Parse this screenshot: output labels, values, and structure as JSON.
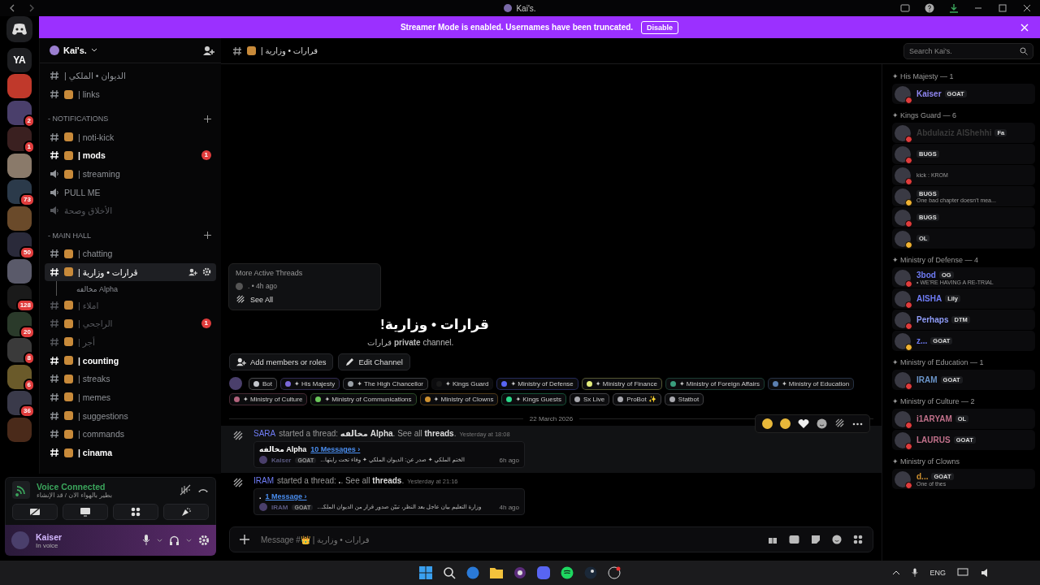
{
  "window": {
    "title": "Kai's."
  },
  "banner": {
    "text": "Streamer Mode is enabled. Usernames have been truncated.",
    "button": "Disable"
  },
  "servers": [
    {
      "label": "YA",
      "color": "#1e1f22"
    },
    {
      "color": "#c0392b"
    },
    {
      "badge": "2",
      "color": "#4a3f6b"
    },
    {
      "badge": "1",
      "color": "#3a2020"
    },
    {
      "color": "#8a7a6a"
    },
    {
      "badge": "73",
      "color": "#2b3a4a"
    },
    {
      "color": "#6a4a2a"
    },
    {
      "badge": "50",
      "color": "#2a2a3a"
    },
    {
      "color": "#5a5a6a"
    },
    {
      "badge": "128",
      "color": "#1a1a1a"
    },
    {
      "badge": "20",
      "color": "#2a3a2a"
    },
    {
      "badge": "8",
      "color": "#3a3a3a"
    },
    {
      "badge": "6",
      "color": "#6a5a2a"
    },
    {
      "badge": "36",
      "color": "#3a3a4a"
    },
    {
      "color": "#4a2a1a"
    }
  ],
  "server": {
    "name": "Kai's."
  },
  "channels": [
    {
      "kind": "text",
      "name": "| الديوان • الملكي",
      "emoji": false,
      "unread": false,
      "muted": false,
      "selected": false
    },
    {
      "kind": "text",
      "name": "| links",
      "emoji": true,
      "unread": false,
      "muted": false,
      "selected": false
    },
    {
      "kind": "category",
      "name": "- NOTIFICATIONS"
    },
    {
      "kind": "text",
      "name": "| noti-kick",
      "emoji": true,
      "unread": false,
      "muted": false,
      "selected": false
    },
    {
      "kind": "text",
      "name": "| mods",
      "emoji": true,
      "unread": true,
      "muted": false,
      "selected": false,
      "badge": "1"
    },
    {
      "kind": "voice",
      "name": "| streaming",
      "emoji": true,
      "unread": false,
      "muted": false,
      "selected": false
    },
    {
      "kind": "voice",
      "name": "PULL ME",
      "emoji": false,
      "unread": false,
      "muted": false,
      "selected": false
    },
    {
      "kind": "voice",
      "name": "الأخلاق وصحة",
      "emoji": false,
      "unread": false,
      "muted": true,
      "selected": false
    },
    {
      "kind": "category",
      "name": "- MAIN HALL"
    },
    {
      "kind": "text",
      "name": "| chatting",
      "emoji": true,
      "unread": false,
      "muted": false,
      "selected": false
    },
    {
      "kind": "text",
      "name": "| قرارات • وزارية",
      "emoji": true,
      "unread": false,
      "muted": false,
      "selected": true
    },
    {
      "kind": "thread",
      "name": "مخالفه Alpha"
    },
    {
      "kind": "text",
      "name": "| املاء",
      "emoji": true,
      "unread": false,
      "muted": true,
      "selected": false
    },
    {
      "kind": "text",
      "name": "| الراجحي",
      "emoji": true,
      "unread": false,
      "muted": true,
      "selected": false,
      "badge": "1"
    },
    {
      "kind": "text",
      "name": "| أجر",
      "emoji": true,
      "unread": false,
      "muted": true,
      "selected": false
    },
    {
      "kind": "text",
      "name": "| counting",
      "emoji": true,
      "unread": true,
      "muted": false,
      "selected": false
    },
    {
      "kind": "text",
      "name": "| streaks",
      "emoji": true,
      "unread": false,
      "muted": false,
      "selected": false
    },
    {
      "kind": "text",
      "name": "| memes",
      "emoji": true,
      "unread": false,
      "muted": false,
      "selected": false
    },
    {
      "kind": "text",
      "name": "| suggestions",
      "emoji": true,
      "unread": false,
      "muted": false,
      "selected": false
    },
    {
      "kind": "text",
      "name": "| commands",
      "emoji": true,
      "unread": false,
      "muted": false,
      "selected": false
    },
    {
      "kind": "text",
      "name": "| cinama",
      "emoji": true,
      "unread": true,
      "muted": false,
      "selected": false
    }
  ],
  "voice": {
    "title": "Voice Connected",
    "channel": "بطير بالهواء الان / قد الإنشاء"
  },
  "user": {
    "name": "Kaiser",
    "status": "In voice"
  },
  "header": {
    "channel": "| قرارات • وزارية",
    "search_placeholder": "Search Kai's."
  },
  "threads_popup": {
    "title": "More Active Threads",
    "item": ". • 4h ago",
    "see_all": "See All"
  },
  "welcome": {
    "title": "قرارات • وزارية!",
    "subtitle": "قرارات **private** channel.",
    "buttons": [
      "Add members or roles",
      "Edit Channel"
    ]
  },
  "roles": [
    {
      "label": "Bot",
      "color": "#c4c6cc"
    },
    {
      "label": "✦ His Majesty",
      "color": "#7b68d9"
    },
    {
      "label": "✦ The High Chancellor",
      "color": "#9aa0a6"
    },
    {
      "label": "✦ Kings Guard",
      "color": "#1a1a1a"
    },
    {
      "label": "✦ Ministry of Defense",
      "color": "#5865f2"
    },
    {
      "label": "✦ Ministry of Finance",
      "color": "#e4ee7c"
    },
    {
      "label": "✦ Ministry of Foreign Affairs",
      "color": "#3a9f7e"
    },
    {
      "label": "✦ Ministry of Education",
      "color": "#5b7fb0"
    },
    {
      "label": "✦ Ministry of Culture",
      "color": "#b4647e"
    },
    {
      "label": "✦ Ministry of Communications",
      "color": "#6ac85a"
    },
    {
      "label": "✦ Ministry of Clowns",
      "color": "#d09230"
    },
    {
      "label": "✦ Kings Guests",
      "color": "#2bd98a"
    },
    {
      "label": "Sx Live",
      "color": "#a8a8ae"
    },
    {
      "label": "ProBot ✨",
      "color": "#a8a8ae"
    },
    {
      "label": "Statbot",
      "color": "#a8a8ae"
    }
  ],
  "date_divider": "22 March 2026",
  "messages": [
    {
      "author": "SARA",
      "text": "started a thread: **مخالفه Alpha**. See all **threads**.",
      "time": "Yesterday at 18:08",
      "highlighted": true,
      "thread": {
        "name": "مخالفه Alpha",
        "count": "10 Messages ›",
        "author": "Kaiser",
        "tag": "GOAT",
        "preview": "الختم الملكي ✦ صدر عن: الديوان الملكي ✦ وفاء تحت رايتها...",
        "ago": "6h ago"
      }
    },
    {
      "author": "IRAM",
      "text": "started a thread: **.**. See all **threads**.",
      "time": "Yesterday at 21:16",
      "highlighted": false,
      "thread": {
        "name": ".",
        "count": "1 Message ›",
        "author": "IRAM",
        "tag": "GOAT",
        "preview": "وزارة التعليم بيان عاجل بعد النظر، تبيّن صدور قرار من الديوان الملكـ...",
        "ago": "4h ago"
      }
    }
  ],
  "composer": {
    "placeholder": "Message #👑 | قرارات • وزارية"
  },
  "member_groups": [
    {
      "title": "✦ His Majesty — 1",
      "members": [
        {
          "name": "Kaiser",
          "color": "#8f86f0",
          "tag": "GOAT",
          "idle": false
        }
      ]
    },
    {
      "title": "✦ Kings Guard — 6",
      "members": [
        {
          "name": "Abdulaziz AlShehhi",
          "color": "#3a3a3a",
          "tag": "Fa",
          "idle": false
        },
        {
          "tag": "BUGS",
          "idle": false
        },
        {
          "status": "kick : KROM",
          "idle": false
        },
        {
          "tag": "BUGS",
          "status": "One bad chapter doesn't mea...",
          "idle": true
        },
        {
          "tag": "BUGS",
          "idle": false
        },
        {
          "tag": "OL",
          "idle": true
        }
      ]
    },
    {
      "title": "✦ Ministry of Defense — 4",
      "members": [
        {
          "name": "3bod",
          "color": "#6f7cf5",
          "tag": "OG",
          "status": "• WE'RE HAVING A RE-TRIAL",
          "idle": false
        },
        {
          "name": "AISHA",
          "color": "#6f7cf5",
          "tag": "Lily",
          "idle": false
        },
        {
          "name": "Perhaps",
          "color": "#8f9cf8",
          "tag": "DTM",
          "idle": false
        },
        {
          "name": "z...",
          "color": "#6f7cf5",
          "tag": "GOAT",
          "idle": true
        }
      ]
    },
    {
      "title": "✦ Ministry of Education — 1",
      "members": [
        {
          "name": "IRAM",
          "color": "#6a94c8",
          "tag": "GOAT",
          "idle": false
        }
      ]
    },
    {
      "title": "✦ Ministry of Culture — 2",
      "members": [
        {
          "name": "i1ARYAM",
          "color": "#c0708a",
          "tag": "OL",
          "idle": false
        },
        {
          "name": "LAURUS",
          "color": "#c0708a",
          "tag": "GOAT",
          "idle": false
        }
      ]
    },
    {
      "title": "✦ Ministry of Clowns",
      "members": [
        {
          "name": "d...",
          "color": "#d09230",
          "tag": "GOAT",
          "status": "One of thes",
          "idle": false
        }
      ]
    }
  ],
  "taskbar": {
    "language": "ENG"
  }
}
